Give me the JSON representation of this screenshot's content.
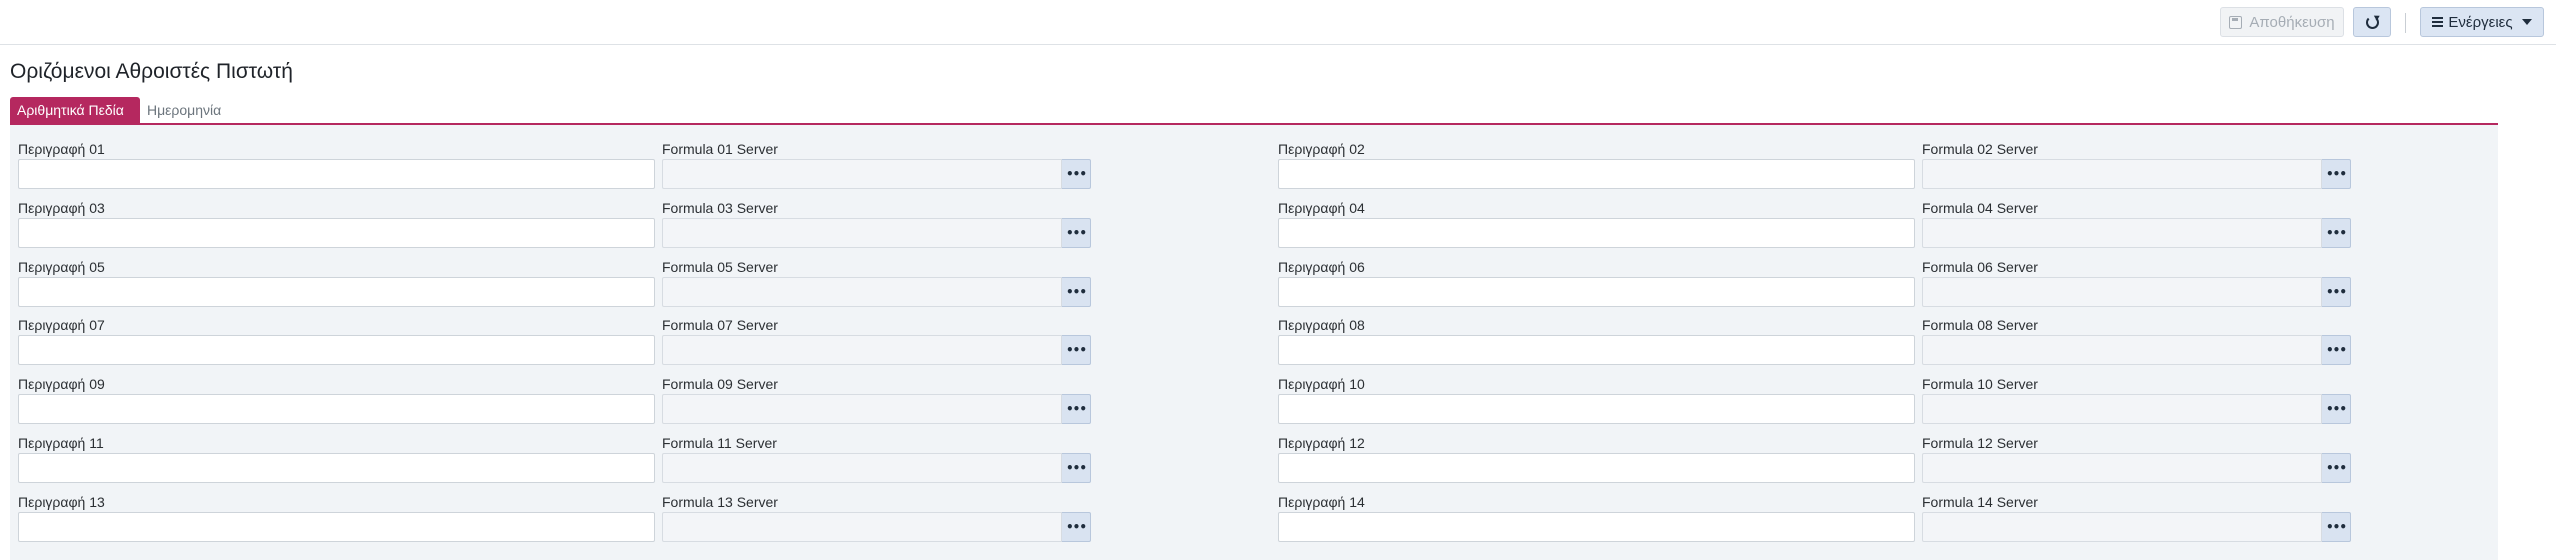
{
  "toolbar": {
    "save_label": "Αποθήκευση",
    "actions_label": "Ενέργειες"
  },
  "page": {
    "title": "Οριζόμενοι Αθροιστές Πιστωτή"
  },
  "tabs": [
    {
      "label": "Αριθμητικά Πεδία",
      "active": true
    },
    {
      "label": "Ημερομηνία",
      "active": false
    }
  ],
  "fields": [
    {
      "desc_label": "Περιγραφή 01",
      "formula_label": "Formula 01 Server"
    },
    {
      "desc_label": "Περιγραφή 02",
      "formula_label": "Formula 02 Server"
    },
    {
      "desc_label": "Περιγραφή 03",
      "formula_label": "Formula 03 Server"
    },
    {
      "desc_label": "Περιγραφή 04",
      "formula_label": "Formula 04 Server"
    },
    {
      "desc_label": "Περιγραφή 05",
      "formula_label": "Formula 05 Server"
    },
    {
      "desc_label": "Περιγραφή 06",
      "formula_label": "Formula 06 Server"
    },
    {
      "desc_label": "Περιγραφή 07",
      "formula_label": "Formula 07 Server"
    },
    {
      "desc_label": "Περιγραφή 08",
      "formula_label": "Formula 08 Server"
    },
    {
      "desc_label": "Περιγραφή 09",
      "formula_label": "Formula 09 Server"
    },
    {
      "desc_label": "Περιγραφή 10",
      "formula_label": "Formula 10 Server"
    },
    {
      "desc_label": "Περιγραφή 11",
      "formula_label": "Formula 11 Server"
    },
    {
      "desc_label": "Περιγραφή 12",
      "formula_label": "Formula 12 Server"
    },
    {
      "desc_label": "Περιγραφή 13",
      "formula_label": "Formula 13 Server"
    },
    {
      "desc_label": "Περιγραφή 14",
      "formula_label": "Formula 14 Server"
    }
  ],
  "formula_button_glyph": "•••",
  "icons": {
    "save": "save-icon",
    "refresh": "refresh-icon",
    "actions": "menu-icon",
    "formula": "ellipsis-icon"
  },
  "colors": {
    "accent": "#b5285f",
    "panel_bg": "#f1f4f7",
    "button_bg": "#d9e3f1"
  }
}
